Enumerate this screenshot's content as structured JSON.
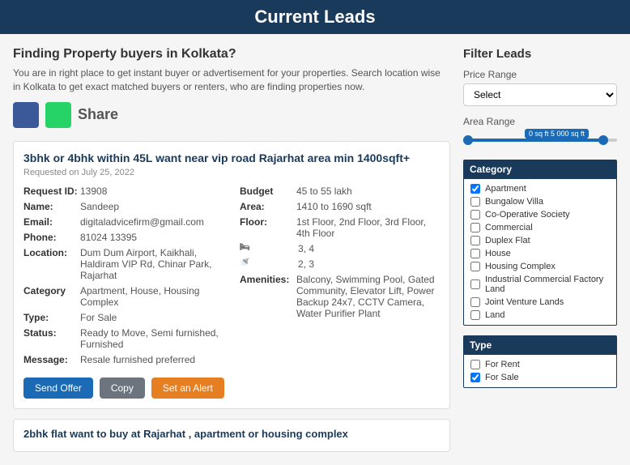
{
  "header": {
    "title": "Current Leads"
  },
  "intro": {
    "heading": "Finding Property buyers in Kolkata?",
    "description": "You are in right place to get instant buyer or advertisement for your properties. Search location wise in Kolkata to get exact matched buyers or renters, who are finding properties now.",
    "share_label": "Share"
  },
  "lead1": {
    "title": "3bhk or 4bhk within 45L want near vip road Rajarhat area min 1400sqft+",
    "date": "Requested on July 25, 2022",
    "request_id_label": "Request ID:",
    "request_id": "13908",
    "name_label": "Name:",
    "name": "Sandeep",
    "email_label": "Email:",
    "email": "digitaladvicefirm@gmail.com",
    "phone_label": "Phone:",
    "phone": "81024 13395",
    "location_label": "Location:",
    "location": "Dum Dum Airport, Kaikhali, Haldiram VIP Rd, Chinar Park, Rajarhat",
    "category_label": "Category",
    "category": "Apartment, House, Housing Complex",
    "type_label": "Type:",
    "type": "For Sale",
    "status_label": "Status:",
    "status": "Ready to Move, Semi furnished, Furnished",
    "message_label": "Message:",
    "message": "Resale furnished preferred",
    "budget_label": "Budget",
    "budget": "45 to 55 lakh",
    "area_label": "Area:",
    "area": "1410 to 1690 sqft",
    "floor_label": "Floor:",
    "floor": "1st Floor, 2nd Floor, 3rd Floor, 4th Floor",
    "bed_label": "",
    "bed": "3, 4",
    "bath_label": "",
    "bath": "2, 3",
    "amenities_label": "Amenities:",
    "amenities": "Balcony, Swimming Pool, Gated Community, Elevator Lift, Power Backup 24x7, CCTV Camera, Water Purifier Plant",
    "btn_send": "Send Offer",
    "btn_copy": "Copy",
    "btn_alert": "Set an Alert"
  },
  "lead2": {
    "title": "2bhk flat want to buy at Rajarhat , apartment or housing complex"
  },
  "filter": {
    "header": "Filter Leads",
    "price_range_label": "Price Range",
    "price_select_placeholder": "Select",
    "area_range_label": "Area Range",
    "area_range_display": "0 sq ft  5 000 sq ft",
    "category_header": "Category",
    "categories": [
      {
        "label": "Apartment",
        "checked": true
      },
      {
        "label": "Bungalow Villa",
        "checked": false
      },
      {
        "label": "Co-Operative Society",
        "checked": false
      },
      {
        "label": "Commercial",
        "checked": false
      },
      {
        "label": "Duplex Flat",
        "checked": false
      },
      {
        "label": "House",
        "checked": false
      },
      {
        "label": "Housing Complex",
        "checked": false
      },
      {
        "label": "Industrial Commercial Factory Land",
        "checked": false
      },
      {
        "label": "Joint Venture Lands",
        "checked": false
      },
      {
        "label": "Land",
        "checked": false
      }
    ],
    "type_header": "Type",
    "types": [
      {
        "label": "For Rent",
        "checked": false
      },
      {
        "label": "For Sale",
        "checked": true
      }
    ]
  }
}
